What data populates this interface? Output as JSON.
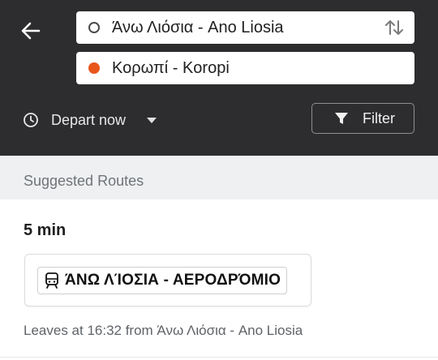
{
  "header": {
    "origin": "Άνω Λιόσια - Ano Liosia",
    "destination": "Κορωπί - Koropi",
    "depart_label": "Depart now",
    "filter_label": "Filter"
  },
  "colors": {
    "header_bg": "#2d2d2f",
    "destination_dot": "#e8561c"
  },
  "icons": {
    "back": "arrow-left-icon",
    "swap": "swap-vertical-icon",
    "clock": "clock-icon",
    "dropdown": "caret-down-icon",
    "filter": "funnel-icon",
    "train": "train-icon"
  },
  "section": {
    "title": "Suggested Routes"
  },
  "route": {
    "duration": "5 min",
    "line_name": "ΆΝΩ ΛΊΟΣΙΑ - ΑΕΡΟΔΡΌΜΙΟ",
    "leaves_text": "Leaves at 16:32 from Άνω Λιόσια - Ano Liosia"
  }
}
